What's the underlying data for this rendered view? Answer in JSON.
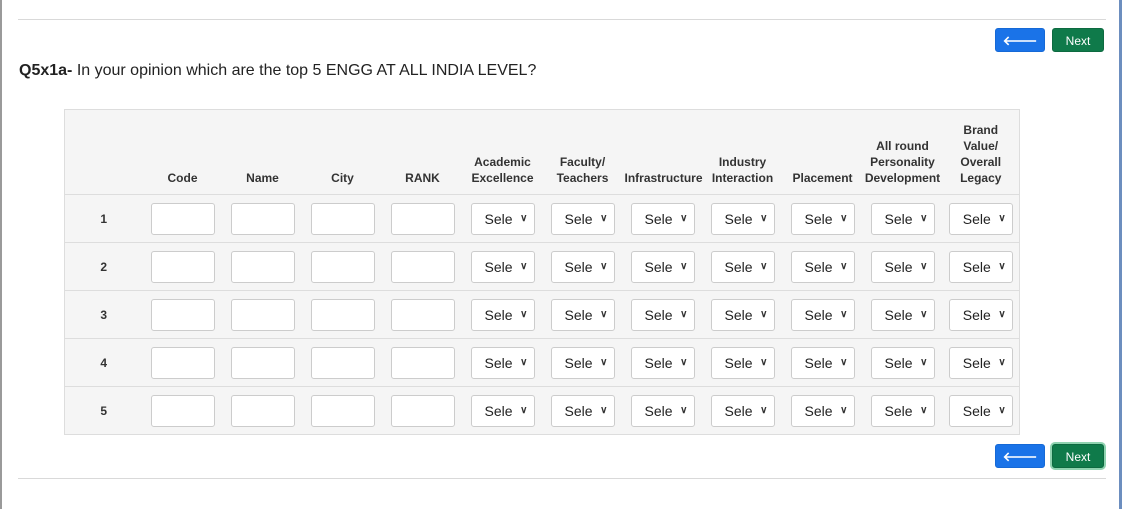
{
  "nav": {
    "prev_label": "Prev",
    "next_label": "Next"
  },
  "question": {
    "id": "Q5x1a-",
    "text": " In your opinion which are the top 5 ENGG AT ALL INDIA LEVEL?"
  },
  "table": {
    "columns": [
      "",
      "Code",
      "Name",
      "City",
      "RANK",
      "Academic Excellence",
      "Faculty/ Teachers",
      "Infrastructure",
      "Industry Interaction",
      "Placement",
      "All round Personality Development",
      "Brand Value/ Overall Legacy"
    ],
    "rows": [
      {
        "num": "1",
        "code": "",
        "name": "",
        "city": "",
        "rank": ""
      },
      {
        "num": "2",
        "code": "",
        "name": "",
        "city": "",
        "rank": ""
      },
      {
        "num": "3",
        "code": "",
        "name": "",
        "city": "",
        "rank": ""
      },
      {
        "num": "4",
        "code": "",
        "name": "",
        "city": "",
        "rank": ""
      },
      {
        "num": "5",
        "code": "",
        "name": "",
        "city": "",
        "rank": ""
      }
    ],
    "select_display": "Sele"
  },
  "colors": {
    "prev_button": "#1a73e8",
    "next_button": "#0f7a4a",
    "table_background": "#f5f5f5"
  },
  "icons": {
    "prev": "arrow-left-icon",
    "next": "arrow-right-icon",
    "select": "chevron-down-icon"
  }
}
